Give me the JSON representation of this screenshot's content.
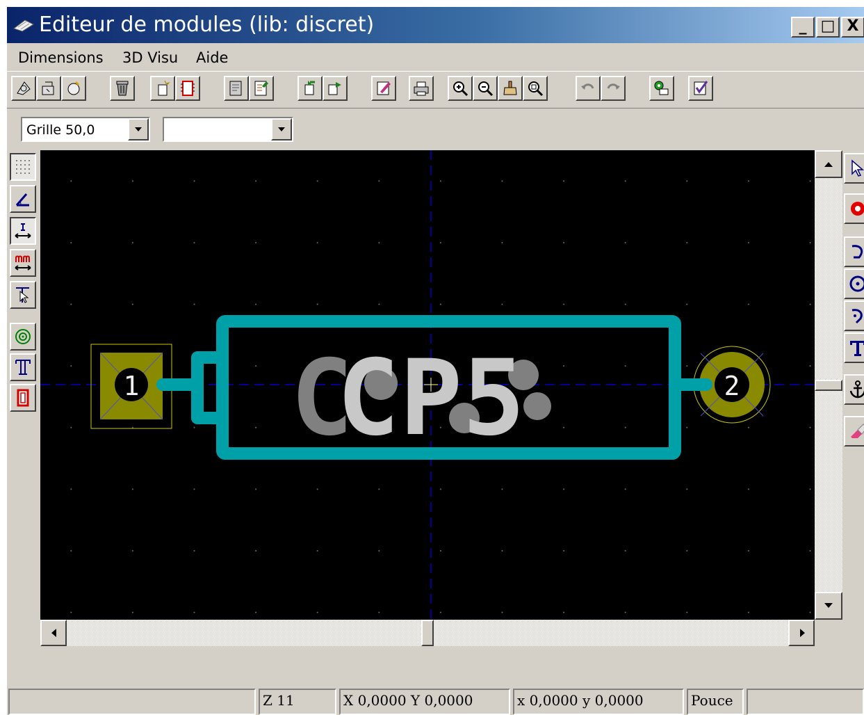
{
  "window": {
    "title": "Editeur de modules (lib: discret)",
    "controls": {
      "minimize": "_",
      "maximize": "□",
      "close": "X"
    }
  },
  "menu": {
    "items": [
      {
        "label": "Dimensions"
      },
      {
        "label": "3D Visu"
      },
      {
        "label": "Aide"
      }
    ]
  },
  "toolbar": {
    "icons": [
      "select-module-icon",
      "load-module-icon",
      "new-module-icon",
      "delete-icon",
      "create-module-icon",
      "module-outline-icon",
      "edit-doc-icon",
      "save-doc-icon",
      "import-module-icon",
      "export-module-icon",
      "properties-icon",
      "print-icon",
      "zoom-in-icon",
      "zoom-out-icon",
      "redraw-icon",
      "zoom-auto-icon",
      "undo-icon",
      "redo-icon",
      "pad-settings-icon",
      "check-icon"
    ]
  },
  "options_bar": {
    "grid_select": {
      "value": "Grille 50,0"
    },
    "zoom_select": {
      "value": ""
    }
  },
  "left_toolbar": {
    "icons": [
      "grid-icon",
      "polar-coords-icon",
      "units-inch-icon",
      "units-mm-icon",
      "cursor-shape-icon",
      "pad-sketch-icon",
      "text-sketch-icon",
      "outline-sketch-icon"
    ]
  },
  "right_toolbar": {
    "icons": [
      "arrow-cursor-icon",
      "add-pad-icon",
      "add-arc-icon",
      "add-circle-icon",
      "add-line-icon",
      "add-text-icon",
      "anchor-icon",
      "delete-eraser-icon"
    ]
  },
  "footprint": {
    "reference": "CP5",
    "pads": [
      {
        "number": "1",
        "shape": "square"
      },
      {
        "number": "2",
        "shape": "round"
      }
    ],
    "colors": {
      "background": "#000000",
      "silkscreen": "#00a0a8",
      "pad": "#8a8a00",
      "text": "#c8c8c8",
      "crosshair": "#0000ff",
      "grid_dot": "#808080"
    }
  },
  "status": {
    "message": "",
    "zoom": "Z 11",
    "abs_coords": "X 0,0000  Y 0,0000",
    "rel_coords": "x 0,0000  y 0,0000",
    "units": "Pouce",
    "extra": ""
  }
}
